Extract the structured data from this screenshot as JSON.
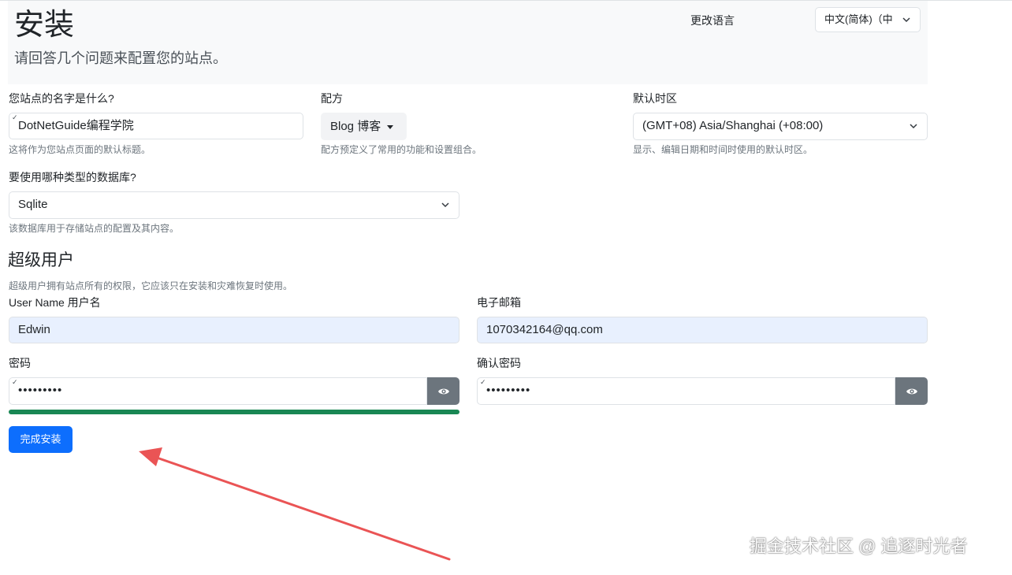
{
  "header": {
    "title": "安装",
    "subtitle": "请回答几个问题来配置您的站点。",
    "language_label": "更改语言",
    "language_value": "中文(简体)（中"
  },
  "site": {
    "name_label": "您站点的名字是什么?",
    "name_value": "DotNetGuide编程学院",
    "name_help": "这将作为您站点页面的默认标题。"
  },
  "recipe": {
    "label": "配方",
    "value": "Blog 博客",
    "help": "配方预定义了常用的功能和设置组合。"
  },
  "timezone": {
    "label": "默认时区",
    "value": "(GMT+08) Asia/Shanghai (+08:00)",
    "help": "显示、编辑日期和时间时使用的默认时区。"
  },
  "database": {
    "label": "要使用哪种类型的数据库?",
    "value": "Sqlite",
    "help": "该数据库用于存储站点的配置及其内容。"
  },
  "superuser": {
    "title": "超级用户",
    "help": "超级用户拥有站点所有的权限，它应该只在安装和灾难恢复时使用。",
    "username_label": "User Name  用户名",
    "username_value": "Edwin",
    "email_label": "电子邮箱",
    "email_value": "1070342164@qq.com",
    "password_label": "密码",
    "password_value": "•••••••••",
    "confirm_label": "确认密码",
    "confirm_value": "•••••••••",
    "password_strength": 1.0
  },
  "submit_label": "完成安装",
  "watermark": "掘金技术社区 @ 追逐时光者",
  "colors": {
    "primary": "#0d6efd",
    "strength_bar": "#198754",
    "eye_button": "#6c757d",
    "annotation_arrow": "#ea5455"
  },
  "icons": [
    "chevron-down-icon",
    "caret-down-icon",
    "eye-icon",
    "annotation-arrow"
  ]
}
